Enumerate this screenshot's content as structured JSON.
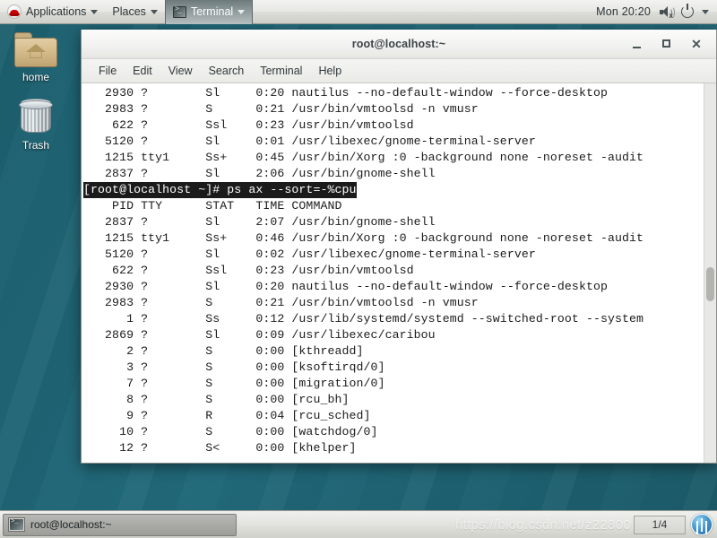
{
  "top_panel": {
    "logo_name": "redhat-logo",
    "applications_label": "Applications",
    "places_label": "Places",
    "active_window_label": "Terminal",
    "clock": "Mon 20:20",
    "volume_icon": "speaker-muted-icon",
    "power_icon": "power-icon"
  },
  "desktop_icons": [
    {
      "label": "home",
      "icon": "home-folder-icon"
    },
    {
      "label": "Trash",
      "icon": "trash-can-icon"
    }
  ],
  "terminal": {
    "title": "root@localhost:~",
    "menu": [
      "File",
      "Edit",
      "View",
      "Search",
      "Terminal",
      "Help"
    ],
    "window_controls": {
      "minimize": "minimize-icon",
      "maximize": "maximize-icon",
      "close": "✕"
    },
    "lines": [
      {
        "text": "   2930 ?        Sl     0:20 nautilus --no-default-window --force-desktop",
        "selected": false
      },
      {
        "text": "   2983 ?        S      0:21 /usr/bin/vmtoolsd -n vmusr",
        "selected": false
      },
      {
        "text": "    622 ?        Ssl    0:23 /usr/bin/vmtoolsd",
        "selected": false
      },
      {
        "text": "   5120 ?        Sl     0:01 /usr/libexec/gnome-terminal-server",
        "selected": false
      },
      {
        "text": "   1215 tty1     Ss+    0:45 /usr/bin/Xorg :0 -background none -noreset -audit",
        "selected": false
      },
      {
        "text": "   2837 ?        Sl     2:06 /usr/bin/gnome-shell",
        "selected": false
      },
      {
        "text": "[root@localhost ~]# ps ax --sort=-%cpu",
        "selected": true
      },
      {
        "text": "    PID TTY      STAT   TIME COMMAND",
        "selected": false
      },
      {
        "text": "   2837 ?        Sl     2:07 /usr/bin/gnome-shell",
        "selected": false
      },
      {
        "text": "   1215 tty1     Ss+    0:46 /usr/bin/Xorg :0 -background none -noreset -audit",
        "selected": false
      },
      {
        "text": "   5120 ?        Sl     0:02 /usr/libexec/gnome-terminal-server",
        "selected": false
      },
      {
        "text": "    622 ?        Ssl    0:23 /usr/bin/vmtoolsd",
        "selected": false
      },
      {
        "text": "   2930 ?        Sl     0:20 nautilus --no-default-window --force-desktop",
        "selected": false
      },
      {
        "text": "   2983 ?        S      0:21 /usr/bin/vmtoolsd -n vmusr",
        "selected": false
      },
      {
        "text": "      1 ?        Ss     0:12 /usr/lib/systemd/systemd --switched-root --system",
        "selected": false
      },
      {
        "text": "   2869 ?        Sl     0:09 /usr/libexec/caribou",
        "selected": false
      },
      {
        "text": "      2 ?        S      0:00 [kthreadd]",
        "selected": false
      },
      {
        "text": "      3 ?        S      0:00 [ksoftirqd/0]",
        "selected": false
      },
      {
        "text": "      7 ?        S      0:00 [migration/0]",
        "selected": false
      },
      {
        "text": "      8 ?        S      0:00 [rcu_bh]",
        "selected": false
      },
      {
        "text": "      9 ?        R      0:04 [rcu_sched]",
        "selected": false
      },
      {
        "text": "     10 ?        S      0:00 [watchdog/0]",
        "selected": false
      },
      {
        "text": "     12 ?        S<     0:00 [khelper]",
        "selected": false
      }
    ]
  },
  "bottom_panel": {
    "task_label": "root@localhost:~",
    "task_icon": "terminal-icon",
    "workspace_indicator": "1/4",
    "orb_icon": "workspace-orb-icon"
  },
  "watermark": "https://blog.csdn.net/z22800"
}
